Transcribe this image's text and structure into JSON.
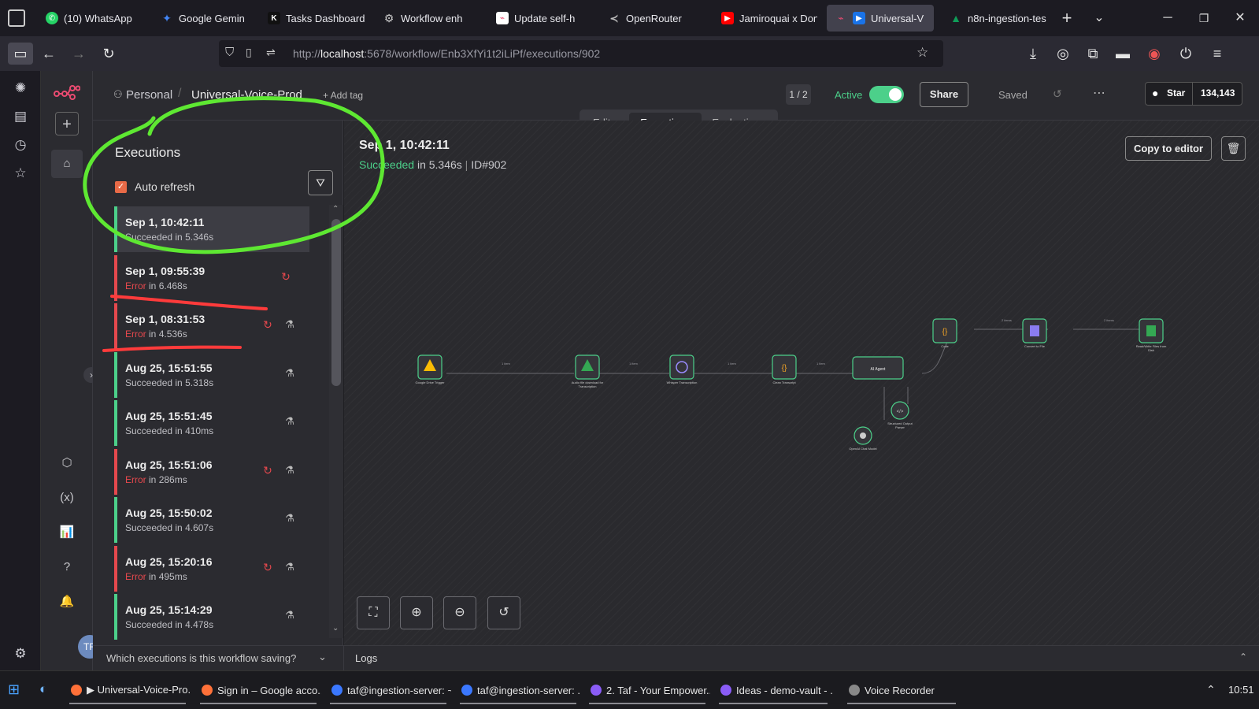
{
  "browser": {
    "tabs": [
      {
        "label": "(10) WhatsApp",
        "color": "#25d366"
      },
      {
        "label": "Google Gemin",
        "color": "#4285f4"
      },
      {
        "label": "Tasks Dashboard",
        "color": "#111111"
      },
      {
        "label": "Workflow enh",
        "color": "#888888"
      },
      {
        "label": "Update self-h",
        "color": "#ffffff"
      },
      {
        "label": "OpenRouter",
        "color": "#888888"
      },
      {
        "label": "Jamiroquai x Don",
        "color": "#ff0000"
      },
      {
        "label": "Universal-V",
        "color": "#1a73e8"
      },
      {
        "label": "n8n-ingestion-tes",
        "color": "#0f9d58"
      }
    ],
    "url_prefix": "http://",
    "url_host": "localhost",
    "url_rest": ":5678/workflow/Enb3XfYi1t2iLiPf/executions/902"
  },
  "header": {
    "project": "Personal",
    "workflow_name": "Universal-Voice-Prod",
    "add_tag": "+ Add tag",
    "page_count": "1 / 2",
    "active_label": "Active",
    "share_label": "Share",
    "saved_label": "Saved",
    "tabs": [
      "Editor",
      "Executions",
      "Evaluations"
    ],
    "star_label": "Star",
    "star_count": "134,143"
  },
  "executions_panel": {
    "title": "Executions",
    "auto_refresh_label": "Auto refresh",
    "items": [
      {
        "time": "Sep 1, 10:42:11",
        "status": "Succeeded",
        "duration": "in 5.346s"
      },
      {
        "time": "Sep 1, 09:55:39",
        "status": "Error",
        "duration": "in 6.468s"
      },
      {
        "time": "Sep 1, 08:31:53",
        "status": "Error",
        "duration": "in 4.536s"
      },
      {
        "time": "Aug 25, 15:51:55",
        "status": "Succeeded",
        "duration": "in 5.318s"
      },
      {
        "time": "Aug 25, 15:51:45",
        "status": "Succeeded",
        "duration": "in 410ms"
      },
      {
        "time": "Aug 25, 15:51:06",
        "status": "Error",
        "duration": "in 286ms"
      },
      {
        "time": "Aug 25, 15:50:02",
        "status": "Succeeded",
        "duration": "in 4.607s"
      },
      {
        "time": "Aug 25, 15:20:16",
        "status": "Error",
        "duration": "in 495ms"
      },
      {
        "time": "Aug 25, 15:14:29",
        "status": "Succeeded",
        "duration": "in 4.478s"
      }
    ],
    "footer_question": "Which executions is this workflow saving?"
  },
  "execution_detail": {
    "title": "Sep 1, 10:42:11",
    "status": "Succeeded",
    "duration": "in 5.346s",
    "id": "ID#902",
    "copy_to_editor": "Copy to editor"
  },
  "logs_label": "Logs",
  "colors": {
    "success": "#4cd08a",
    "error": "#e5484d",
    "active_toggle": "#4cd08a",
    "n8n_logo": "#ea4b71"
  },
  "taskbar": {
    "items": [
      "▶ Universal-Voice-Pro...",
      "Sign in – Google acco...",
      "taf@ingestion-server: ~",
      "taf@ingestion-server: ...",
      "2. Taf - Your Empower...",
      "Ideas - demo-vault - ...",
      "Voice Recorder"
    ],
    "clock": "10:51"
  },
  "user_initials": "TR"
}
